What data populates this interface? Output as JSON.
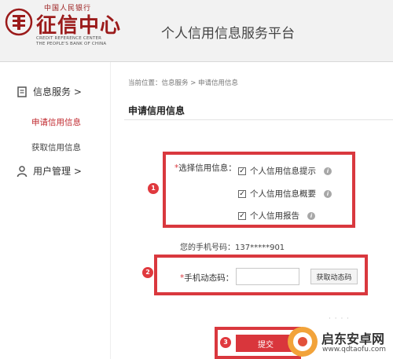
{
  "header": {
    "logo_top": "中国人民银行",
    "logo_main": "征信中心",
    "logo_en_line1": "CREDIT REFERENCE CENTER",
    "logo_en_line2": "THE PEOPLE'S BANK OF CHINA",
    "site_title": "个人信用信息服务平台"
  },
  "sidebar": {
    "info_service": "信息服务 >",
    "apply_credit": "申请信用信息",
    "get_credit": "获取信用信息",
    "user_manage": "用户管理 >"
  },
  "main": {
    "breadcrumb": "当前位置：信息服务 > 申请信用信息",
    "heading": "申请信用信息",
    "select_label_req": "*",
    "select_label": "选择信用信息：",
    "options": [
      "个人信用信息提示",
      "个人信用信息概要",
      "个人信用报告"
    ],
    "info_glyph": "i",
    "check_glyph": "✓",
    "phone_label": "您的手机号码：",
    "phone_value": "137*****901",
    "code_label_req": "*",
    "code_label": "手机动态码：",
    "code_value": "",
    "get_code_button": "获取动态码",
    "submit_button": "提交",
    "badges": [
      "1",
      "2",
      "3"
    ]
  },
  "watermark": {
    "name": "启东安卓网",
    "url": "www.qdtaofu.com"
  },
  "colors": {
    "brand_red": "#9b1b1b",
    "highlight_red": "#d9383e"
  }
}
